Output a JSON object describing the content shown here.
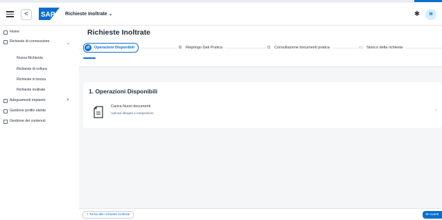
{
  "shell": {
    "back_glyph": "<",
    "app_title": "Richieste Inoltrate ⌄",
    "avatar_initials": "M",
    "accent_color": "#0a6ed1"
  },
  "sidebar": {
    "items": [
      {
        "label": "Home"
      },
      {
        "label": "Richieste di connessione",
        "chevron": "⌄"
      },
      {
        "label": "Nuova Richiesta"
      },
      {
        "label": "Richieste di voltura"
      },
      {
        "label": "Richieste in bozza"
      },
      {
        "label": "Richieste inoltrate"
      },
      {
        "label": "Adeguamenti impianto",
        "chevron": ">"
      },
      {
        "label": "Gestione profilo utente"
      },
      {
        "label": "Gestione dei contenuti"
      }
    ]
  },
  "main": {
    "title": "Richieste Inoltrate",
    "steps": [
      {
        "label": "Operazioni Disponibili",
        "icon": "operations-icon"
      },
      {
        "label": "Riepilogo Dati Pratica",
        "icon": "summary-icon"
      },
      {
        "label": "Consultazione documenti pratica",
        "icon": "documents-icon"
      },
      {
        "label": "Storico della richiesta",
        "icon": "history-icon"
      }
    ],
    "section": {
      "title": "1. Operazioni Disponibili",
      "item": {
        "title": "Carica Nuovi documenti",
        "description": "Upload allegati e integrazioni",
        "chevron": "›"
      }
    }
  },
  "footer": {
    "back_label": "<  Torna alle richieste inoltrate",
    "next_label": "≫ Avanti"
  }
}
